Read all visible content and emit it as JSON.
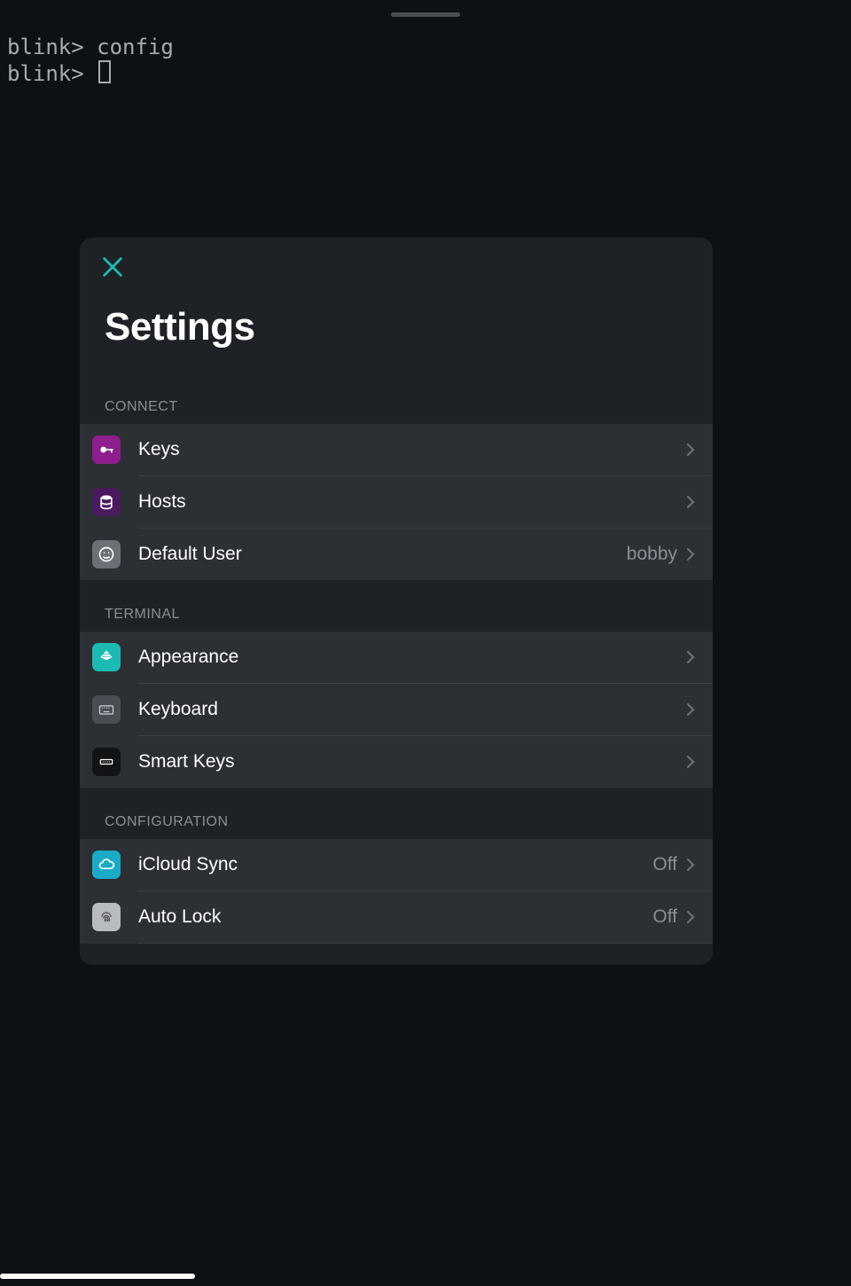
{
  "terminal": {
    "prompt": "blink>",
    "line1_command": "config",
    "line2_command": ""
  },
  "modal": {
    "title": "Settings",
    "close_icon": "close-icon",
    "sections": [
      {
        "header": "CONNECT",
        "rows": [
          {
            "icon": "key-icon",
            "icon_bg": "purple",
            "label": "Keys",
            "value": ""
          },
          {
            "icon": "database-icon",
            "icon_bg": "purple-dk",
            "label": "Hosts",
            "value": ""
          },
          {
            "icon": "face-icon",
            "icon_bg": "gray",
            "label": "Default User",
            "value": "bobby"
          }
        ]
      },
      {
        "header": "TERMINAL",
        "rows": [
          {
            "icon": "appearance-icon",
            "icon_bg": "teal",
            "label": "Appearance",
            "value": ""
          },
          {
            "icon": "keyboard-icon",
            "icon_bg": "darkgray",
            "label": "Keyboard",
            "value": ""
          },
          {
            "icon": "smartkeys-icon",
            "icon_bg": "black",
            "label": "Smart Keys",
            "value": ""
          }
        ]
      },
      {
        "header": "CONFIGURATION",
        "rows": [
          {
            "icon": "cloud-icon",
            "icon_bg": "cyan",
            "label": "iCloud Sync",
            "value": "Off"
          },
          {
            "icon": "fingerprint-icon",
            "icon_bg": "lightgray",
            "label": "Auto Lock",
            "value": "Off"
          }
        ]
      }
    ]
  },
  "colors": {
    "accent_teal": "#1bbab3",
    "modal_bg": "#1e2125",
    "row_bg": "#2c2f34",
    "page_bg": "#0d1014"
  }
}
